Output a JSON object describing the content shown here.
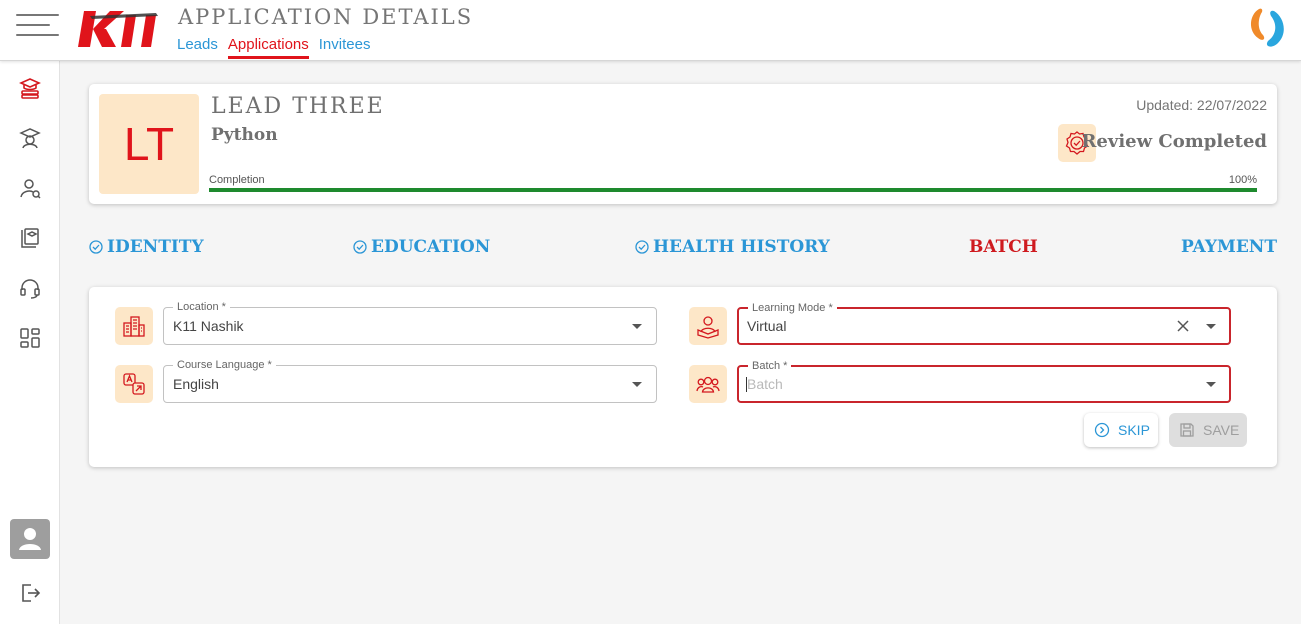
{
  "header": {
    "title": "APPLICATION DETAILS",
    "logo_text": "Kii",
    "nav": [
      {
        "label": "Leads",
        "active": false
      },
      {
        "label": "Applications",
        "active": true
      },
      {
        "label": "Invitees",
        "active": false
      }
    ]
  },
  "sidebar": {
    "items": [
      {
        "icon": "graduation-books-icon",
        "active": true
      },
      {
        "icon": "student-icon",
        "active": false
      },
      {
        "icon": "user-search-icon",
        "active": false
      },
      {
        "icon": "books-icon",
        "active": false
      },
      {
        "icon": "headset-icon",
        "active": false
      },
      {
        "icon": "dashboard-grid-icon",
        "active": false
      }
    ],
    "bottom": [
      "user-avatar-icon",
      "logout-icon"
    ]
  },
  "lead": {
    "initials": "LT",
    "name": "LEAD THREE",
    "course": "Python",
    "updated": "Updated: 22/07/2022",
    "status": "Review Completed",
    "completion_label": "Completion",
    "completion_percent": "100%",
    "completion_value": 1.0
  },
  "steps": [
    {
      "label": "IDENTITY",
      "done": true,
      "active": false
    },
    {
      "label": "EDUCATION",
      "done": true,
      "active": false
    },
    {
      "label": "HEALTH HISTORY",
      "done": true,
      "active": false
    },
    {
      "label": "BATCH",
      "done": false,
      "active": true
    },
    {
      "label": "PAYMENT",
      "done": false,
      "active": false
    }
  ],
  "form": {
    "location": {
      "label": "Location *",
      "value": "K11 Nashik"
    },
    "learning_mode": {
      "label": "Learning Mode *",
      "value": "Virtual"
    },
    "course_language": {
      "label": "Course Language *",
      "value": "English"
    },
    "batch": {
      "label": "Batch *",
      "placeholder": "Batch",
      "value": ""
    },
    "skip_label": "SKIP",
    "save_label": "SAVE"
  },
  "colors": {
    "accent_red": "#e0141b",
    "link_blue": "#2b96d6",
    "progress_green": "#1e8a2e",
    "icon_bg": "#fde7c8"
  }
}
